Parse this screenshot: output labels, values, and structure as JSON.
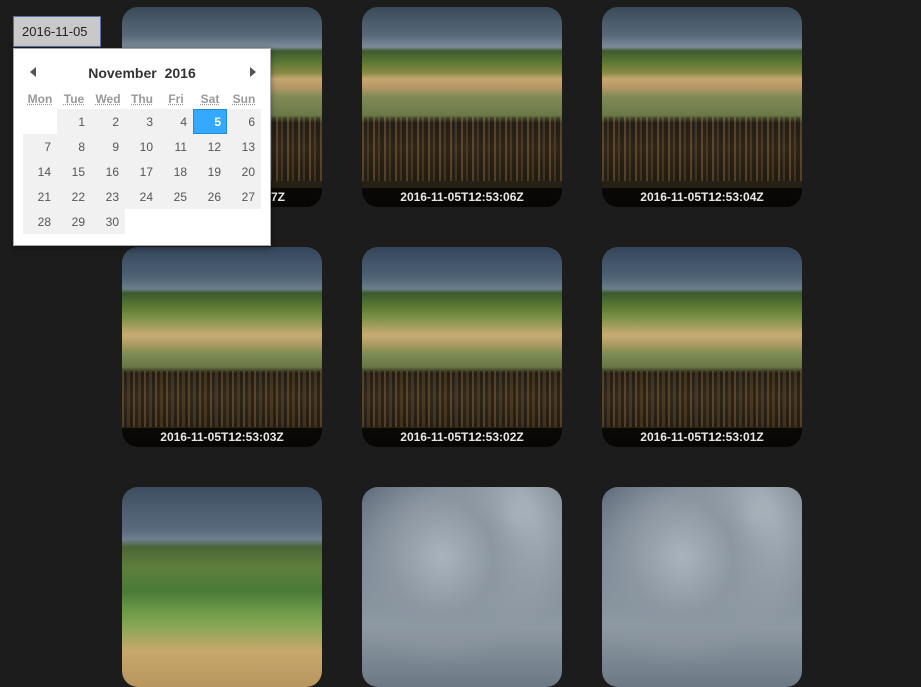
{
  "date_input": {
    "value": "2016-11-05"
  },
  "calendar": {
    "month": "November",
    "year": "2016",
    "weekdays": [
      "Mon",
      "Tue",
      "Wed",
      "Thu",
      "Fri",
      "Sat",
      "Sun"
    ],
    "weeks": [
      [
        "",
        "1",
        "2",
        "3",
        "4",
        "5",
        "6"
      ],
      [
        "7",
        "8",
        "9",
        "10",
        "11",
        "12",
        "13"
      ],
      [
        "14",
        "15",
        "16",
        "17",
        "18",
        "19",
        "20"
      ],
      [
        "21",
        "22",
        "23",
        "24",
        "25",
        "26",
        "27"
      ],
      [
        "28",
        "29",
        "30",
        "",
        "",
        "",
        ""
      ]
    ],
    "selected_day": "5"
  },
  "photos": [
    {
      "caption": "7Z"
    },
    {
      "caption": "2016-11-05T12:53:06Z"
    },
    {
      "caption": "2016-11-05T12:53:04Z"
    },
    {
      "caption": "2016-11-05T12:53:03Z"
    },
    {
      "caption": "2016-11-05T12:53:02Z"
    },
    {
      "caption": "2016-11-05T12:53:01Z"
    },
    {
      "caption": ""
    },
    {
      "caption": ""
    },
    {
      "caption": ""
    }
  ]
}
